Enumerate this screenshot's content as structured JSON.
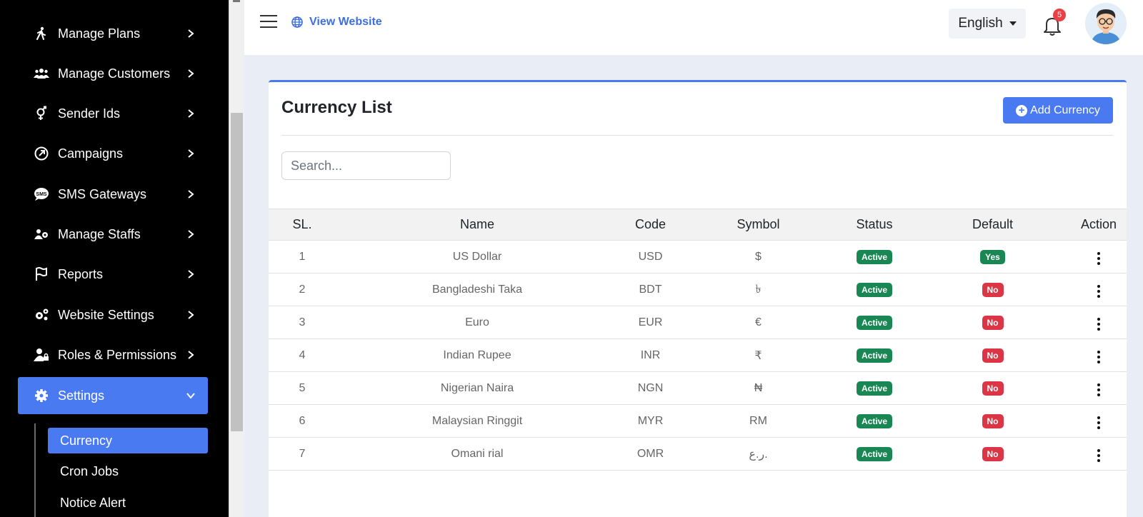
{
  "sidebar": {
    "items": [
      {
        "label": "Manage Plans",
        "icon": "walking-person-icon"
      },
      {
        "label": "Manage Customers",
        "icon": "users-icon"
      },
      {
        "label": "Sender Ids",
        "icon": "gender-icon"
      },
      {
        "label": "Campaigns",
        "icon": "campaign-icon"
      },
      {
        "label": "SMS Gateways",
        "icon": "sms-icon"
      },
      {
        "label": "Manage Staffs",
        "icon": "staff-icon"
      },
      {
        "label": "Reports",
        "icon": "flag-icon"
      },
      {
        "label": "Website Settings",
        "icon": "gears-icon"
      },
      {
        "label": "Roles & Permissions",
        "icon": "user-lock-icon"
      },
      {
        "label": "Settings",
        "icon": "gear-icon",
        "active": true
      }
    ],
    "sub_items": [
      {
        "label": "Currency",
        "active": true
      },
      {
        "label": "Cron Jobs"
      },
      {
        "label": "Notice Alert"
      }
    ]
  },
  "topbar": {
    "view_website": "View Website",
    "language": "English",
    "notification_count": "5"
  },
  "card": {
    "title": "Currency List",
    "add_button": "Add Currency",
    "search_placeholder": "Search..."
  },
  "table": {
    "headers": [
      "SL.",
      "Name",
      "Code",
      "Symbol",
      "Status",
      "Default",
      "Action"
    ],
    "rows": [
      {
        "sl": "1",
        "name": "US Dollar",
        "code": "USD",
        "symbol": "$",
        "status": "Active",
        "default": "Yes"
      },
      {
        "sl": "2",
        "name": "Bangladeshi Taka",
        "code": "BDT",
        "symbol": "৳",
        "status": "Active",
        "default": "No"
      },
      {
        "sl": "3",
        "name": "Euro",
        "code": "EUR",
        "symbol": "€",
        "status": "Active",
        "default": "No"
      },
      {
        "sl": "4",
        "name": "Indian Rupee",
        "code": "INR",
        "symbol": "₹",
        "status": "Active",
        "default": "No"
      },
      {
        "sl": "5",
        "name": "Nigerian Naira",
        "code": "NGN",
        "symbol": "₦",
        "status": "Active",
        "default": "No"
      },
      {
        "sl": "6",
        "name": "Malaysian Ringgit",
        "code": "MYR",
        "symbol": "RM",
        "status": "Active",
        "default": "No"
      },
      {
        "sl": "7",
        "name": "Omani rial",
        "code": "OMR",
        "symbol": "ر.ع.",
        "status": "Active",
        "default": "No"
      }
    ]
  },
  "colors": {
    "accent": "#4a7af2",
    "active_green": "#198754",
    "no_red": "#dc3545",
    "sidebar_bg": "#000000"
  }
}
